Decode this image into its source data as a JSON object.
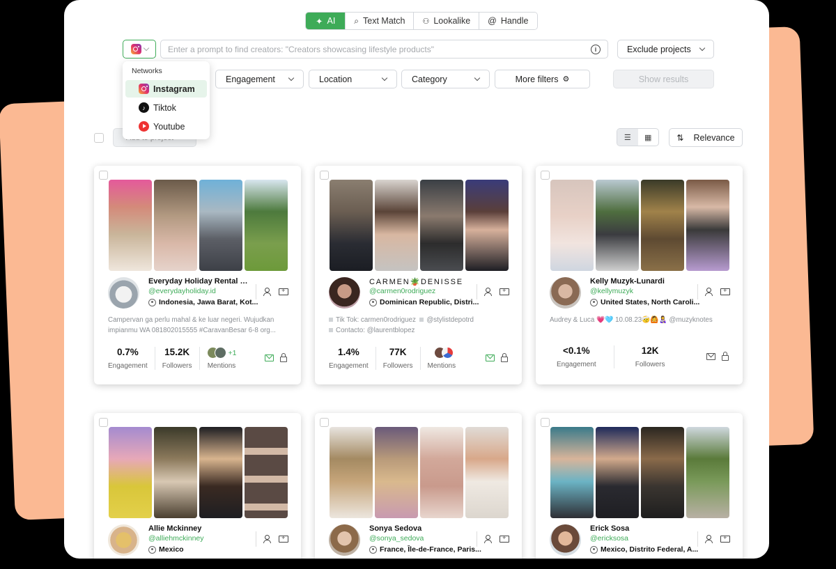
{
  "modes": [
    {
      "label": "AI",
      "icon": "sparkle-icon",
      "active": true
    },
    {
      "label": "Text Match",
      "icon": "search-icon",
      "active": false
    },
    {
      "label": "Lookalike",
      "icon": "person-search-icon",
      "active": false
    },
    {
      "label": "Handle",
      "icon": "at-icon",
      "active": false
    }
  ],
  "search": {
    "placeholder": "Enter a prompt to find creators: \"Creators showcasing lifestyle products\"",
    "exclude_label": "Exclude projects"
  },
  "filters": {
    "engagement": "Engagement",
    "location": "Location",
    "category": "Category",
    "more": "More filters",
    "show_results": "Show results"
  },
  "networks_menu": {
    "header": "Networks",
    "items": [
      "Instagram",
      "Tiktok",
      "Youtube"
    ],
    "selected": "Instagram"
  },
  "toolbar": {
    "add_to_project": "Add to project",
    "sort_label": "Relevance"
  },
  "accent_color": "#3eab58",
  "creators": [
    {
      "name": "Everyday Holiday Rental Camp...",
      "handle": "@everydayholiday.id",
      "location": "Indonesia, Jawa Barat, Kot...",
      "bio": [
        "Campervan ga perlu mahal & ke luar negeri. Wujudkan",
        "impianmu WA 081802015555 #CaravanBesar 6-8 org..."
      ],
      "engagement": "0.7%",
      "followers": "15.2K",
      "mentions_extra": "+1",
      "labels": {
        "engagement": "Engagement",
        "followers": "Followers",
        "mentions": "Mentions"
      }
    },
    {
      "name": "CARMEN🪴DENISSE",
      "handle": "@carmen0rodriguez",
      "location": "Dominican Republic, Distri...",
      "bio_items": [
        "Tik Tok: carmen0rodriguez",
        "@stylistdepotrd",
        "Contacto: @laurentblopez"
      ],
      "engagement": "1.4%",
      "followers": "77K",
      "labels": {
        "engagement": "Engagement",
        "followers": "Followers",
        "mentions": "Mentions"
      }
    },
    {
      "name": "Kelly Muzyk-Lunardi",
      "handle": "@kellymuzyk",
      "location": "United States, North Caroli...",
      "bio": [
        "Audrey & Luca 💗🩵 10.08.23🤕🙆👩‍🍼 @muzyknotes"
      ],
      "engagement": "<0.1%",
      "followers": "12K",
      "labels": {
        "engagement": "Engagement",
        "followers": "Followers"
      }
    },
    {
      "name": "Allie Mckinney",
      "handle": "@alliehmckinney",
      "location": "Mexico"
    },
    {
      "name": "Sonya Sedova",
      "handle": "@sonya_sedova",
      "location": "France, Île-de-France, Paris..."
    },
    {
      "name": "Erick Sosa",
      "handle": "@ericksosa",
      "location": "Mexico, Distrito Federal, A..."
    }
  ]
}
